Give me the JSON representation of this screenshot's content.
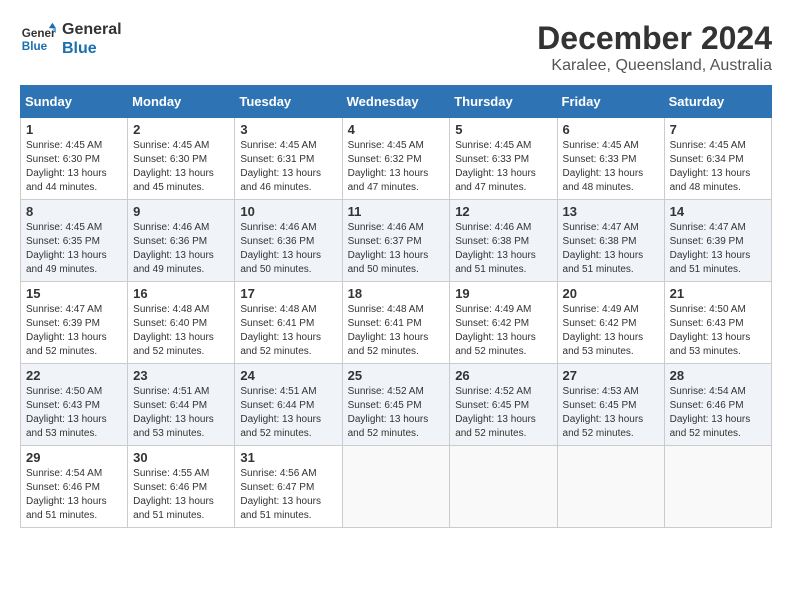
{
  "header": {
    "logo_line1": "General",
    "logo_line2": "Blue",
    "month_title": "December 2024",
    "location": "Karalee, Queensland, Australia"
  },
  "days_of_week": [
    "Sunday",
    "Monday",
    "Tuesday",
    "Wednesday",
    "Thursday",
    "Friday",
    "Saturday"
  ],
  "weeks": [
    [
      {
        "day": "1",
        "sunrise": "4:45 AM",
        "sunset": "6:30 PM",
        "daylight": "13 hours and 44 minutes."
      },
      {
        "day": "2",
        "sunrise": "4:45 AM",
        "sunset": "6:30 PM",
        "daylight": "13 hours and 45 minutes."
      },
      {
        "day": "3",
        "sunrise": "4:45 AM",
        "sunset": "6:31 PM",
        "daylight": "13 hours and 46 minutes."
      },
      {
        "day": "4",
        "sunrise": "4:45 AM",
        "sunset": "6:32 PM",
        "daylight": "13 hours and 47 minutes."
      },
      {
        "day": "5",
        "sunrise": "4:45 AM",
        "sunset": "6:33 PM",
        "daylight": "13 hours and 47 minutes."
      },
      {
        "day": "6",
        "sunrise": "4:45 AM",
        "sunset": "6:33 PM",
        "daylight": "13 hours and 48 minutes."
      },
      {
        "day": "7",
        "sunrise": "4:45 AM",
        "sunset": "6:34 PM",
        "daylight": "13 hours and 48 minutes."
      }
    ],
    [
      {
        "day": "8",
        "sunrise": "4:45 AM",
        "sunset": "6:35 PM",
        "daylight": "13 hours and 49 minutes."
      },
      {
        "day": "9",
        "sunrise": "4:46 AM",
        "sunset": "6:36 PM",
        "daylight": "13 hours and 49 minutes."
      },
      {
        "day": "10",
        "sunrise": "4:46 AM",
        "sunset": "6:36 PM",
        "daylight": "13 hours and 50 minutes."
      },
      {
        "day": "11",
        "sunrise": "4:46 AM",
        "sunset": "6:37 PM",
        "daylight": "13 hours and 50 minutes."
      },
      {
        "day": "12",
        "sunrise": "4:46 AM",
        "sunset": "6:38 PM",
        "daylight": "13 hours and 51 minutes."
      },
      {
        "day": "13",
        "sunrise": "4:47 AM",
        "sunset": "6:38 PM",
        "daylight": "13 hours and 51 minutes."
      },
      {
        "day": "14",
        "sunrise": "4:47 AM",
        "sunset": "6:39 PM",
        "daylight": "13 hours and 51 minutes."
      }
    ],
    [
      {
        "day": "15",
        "sunrise": "4:47 AM",
        "sunset": "6:39 PM",
        "daylight": "13 hours and 52 minutes."
      },
      {
        "day": "16",
        "sunrise": "4:48 AM",
        "sunset": "6:40 PM",
        "daylight": "13 hours and 52 minutes."
      },
      {
        "day": "17",
        "sunrise": "4:48 AM",
        "sunset": "6:41 PM",
        "daylight": "13 hours and 52 minutes."
      },
      {
        "day": "18",
        "sunrise": "4:48 AM",
        "sunset": "6:41 PM",
        "daylight": "13 hours and 52 minutes."
      },
      {
        "day": "19",
        "sunrise": "4:49 AM",
        "sunset": "6:42 PM",
        "daylight": "13 hours and 52 minutes."
      },
      {
        "day": "20",
        "sunrise": "4:49 AM",
        "sunset": "6:42 PM",
        "daylight": "13 hours and 53 minutes."
      },
      {
        "day": "21",
        "sunrise": "4:50 AM",
        "sunset": "6:43 PM",
        "daylight": "13 hours and 53 minutes."
      }
    ],
    [
      {
        "day": "22",
        "sunrise": "4:50 AM",
        "sunset": "6:43 PM",
        "daylight": "13 hours and 53 minutes."
      },
      {
        "day": "23",
        "sunrise": "4:51 AM",
        "sunset": "6:44 PM",
        "daylight": "13 hours and 53 minutes."
      },
      {
        "day": "24",
        "sunrise": "4:51 AM",
        "sunset": "6:44 PM",
        "daylight": "13 hours and 52 minutes."
      },
      {
        "day": "25",
        "sunrise": "4:52 AM",
        "sunset": "6:45 PM",
        "daylight": "13 hours and 52 minutes."
      },
      {
        "day": "26",
        "sunrise": "4:52 AM",
        "sunset": "6:45 PM",
        "daylight": "13 hours and 52 minutes."
      },
      {
        "day": "27",
        "sunrise": "4:53 AM",
        "sunset": "6:45 PM",
        "daylight": "13 hours and 52 minutes."
      },
      {
        "day": "28",
        "sunrise": "4:54 AM",
        "sunset": "6:46 PM",
        "daylight": "13 hours and 52 minutes."
      }
    ],
    [
      {
        "day": "29",
        "sunrise": "4:54 AM",
        "sunset": "6:46 PM",
        "daylight": "13 hours and 51 minutes."
      },
      {
        "day": "30",
        "sunrise": "4:55 AM",
        "sunset": "6:46 PM",
        "daylight": "13 hours and 51 minutes."
      },
      {
        "day": "31",
        "sunrise": "4:56 AM",
        "sunset": "6:47 PM",
        "daylight": "13 hours and 51 minutes."
      },
      null,
      null,
      null,
      null
    ]
  ]
}
